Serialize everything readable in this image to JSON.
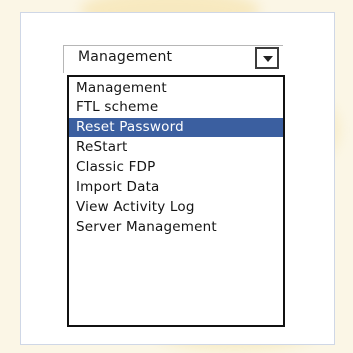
{
  "select": {
    "current_value": "Management",
    "options": [
      "Management",
      "FTL scheme",
      "Reset Password",
      "ReStart",
      "Classic FDP",
      "Import Data",
      "View Activity Log",
      "Server Management"
    ],
    "highlighted_option": "Reset Password"
  },
  "icons": {
    "dropdown": "chevron-down-icon"
  },
  "colors": {
    "highlight": "#3b5fa0",
    "highlight_text": "#ffffff",
    "list_border": "#111111",
    "background": "#fbf6e6"
  }
}
